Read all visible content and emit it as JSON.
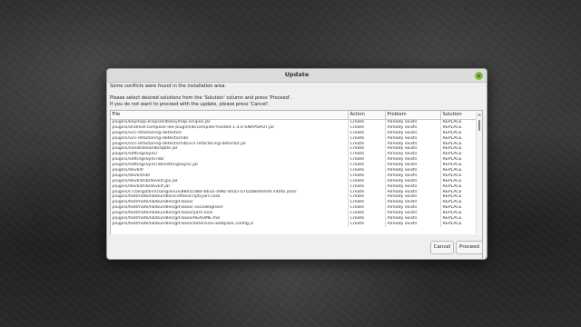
{
  "dialog": {
    "title": "Update",
    "message_conflicts": "Some conflicts were found in the installation area.",
    "message_select": "Please select desired solutions from the 'Solution' column and press 'Proceed'.",
    "message_cancel": "If you do not want to proceed with the update, please press 'Cancel'.",
    "close_icon": "close-icon",
    "accent_color": "#86be43"
  },
  "table": {
    "columns": [
      "File",
      "Action",
      "Problem",
      "Solution"
    ],
    "rows": [
      [
        "plugins/keymap-eclipse/lib/keymap-eclipse.jar",
        "Create",
        "Already exists",
        "REPLACE"
      ],
      [
        "plugins/android-compose-ide-plugin/lib/compiler-hosted-1.4.0-SNAPSHOT.jar",
        "Create",
        "Already exists",
        "REPLACE"
      ],
      [
        "plugins/vcs-refactoring-detector/",
        "Create",
        "Already exists",
        "REPLACE"
      ],
      [
        "plugins/vcs-refactoring-detector/lib/",
        "Create",
        "Already exists",
        "REPLACE"
      ],
      [
        "plugins/vcs-refactoring-detector/lib/vcs-refactoring-detector.jar",
        "Create",
        "Already exists",
        "REPLACE"
      ],
      [
        "plugins/sonatdeea/lib/sqlite.jar",
        "Create",
        "Already exists",
        "REPLACE"
      ],
      [
        "plugins/settingsSync/",
        "Create",
        "Already exists",
        "REPLACE"
      ],
      [
        "plugins/settingsSync/lib/",
        "Create",
        "Already exists",
        "REPLACE"
      ],
      [
        "plugins/settingsSync/lib/settingsSync.jar",
        "Create",
        "Already exists",
        "REPLACE"
      ],
      [
        "plugins/devkit/",
        "Create",
        "Already exists",
        "REPLACE"
      ],
      [
        "plugins/devkit/lib/",
        "Create",
        "Already exists",
        "REPLACE"
      ],
      [
        "plugins/devkit/lib/devkit-jps.jar",
        "Create",
        "Already exists",
        "REPLACE"
      ],
      [
        "plugins/devkit/lib/devkit.jar",
        "Create",
        "Already exists",
        "REPLACE"
      ],
      [
        "plugins/c-clangd/bin/clang/linux/88e5cd8e-bb35-498c-b0a5-0702b8efa449.intoto.jsonl",
        "Create",
        "Already exists",
        "REPLACE"
      ],
      [
        "plugins/textmate/lib/bundles/coffeescript/yarn.lock",
        "Create",
        "Already exists",
        "REPLACE"
      ],
      [
        "plugins/textmate/lib/bundles/git-base/",
        "Create",
        "Already exists",
        "REPLACE"
      ],
      [
        "plugins/textmate/lib/bundles/git-base/.vscodeignore",
        "Create",
        "Already exists",
        "REPLACE"
      ],
      [
        "plugins/textmate/lib/bundles/git-base/yarn.lock",
        "Create",
        "Already exists",
        "REPLACE"
      ],
      [
        "plugins/textmate/lib/bundles/git-base/README.md",
        "Create",
        "Already exists",
        "REPLACE"
      ],
      [
        "plugins/textmate/lib/bundles/git-base/extension.webpack.config.js",
        "Create",
        "Already exists",
        "REPLACE"
      ]
    ]
  },
  "buttons": {
    "cancel": "Cancel",
    "proceed": "Proceed"
  }
}
